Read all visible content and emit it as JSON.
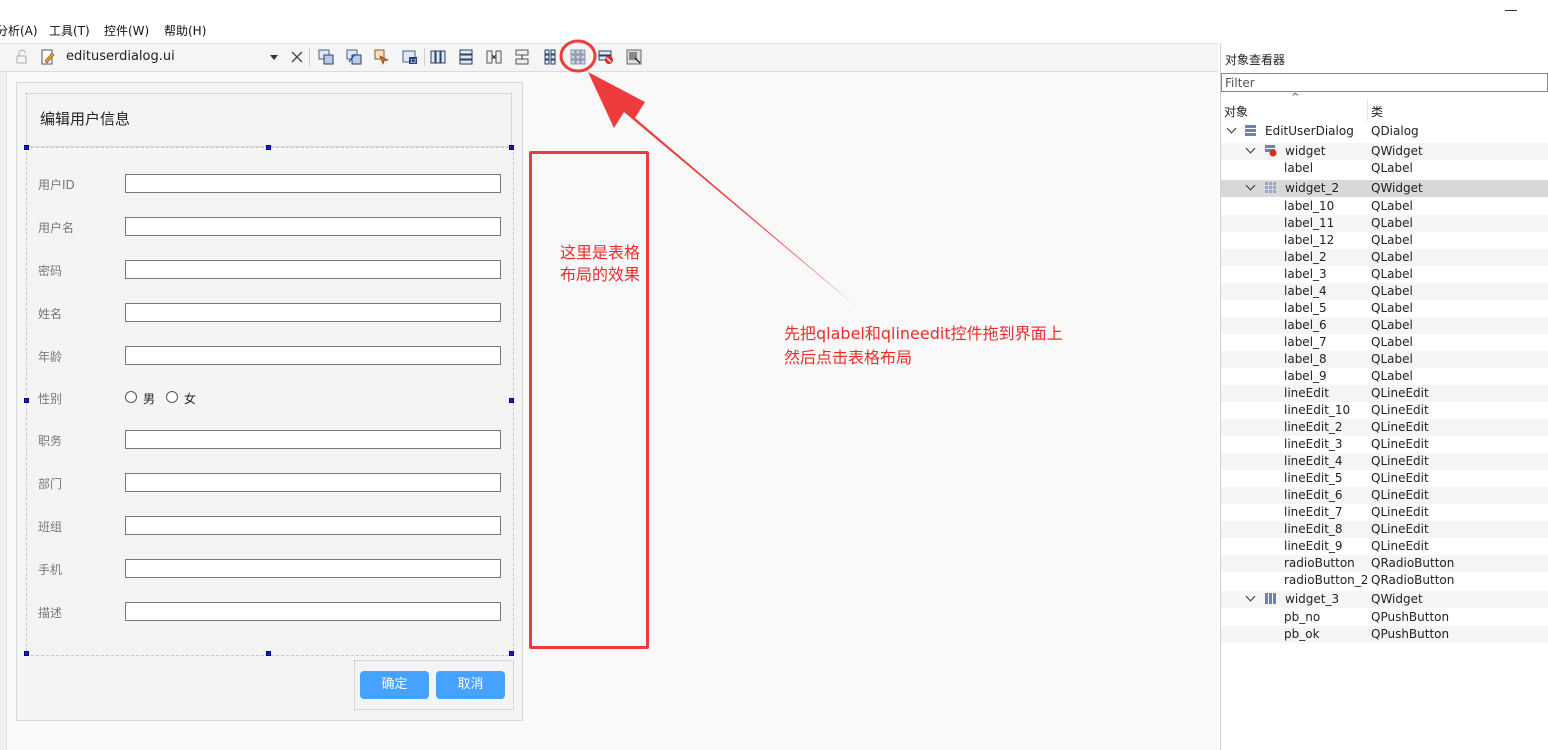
{
  "menubar": {
    "items": [
      {
        "label": "分析(A)"
      },
      {
        "label": "工具(T)"
      },
      {
        "label": "控件(W)"
      },
      {
        "label": "帮助(H)"
      }
    ]
  },
  "toolbar": {
    "file_name": "edituserdialog.ui",
    "icons": [
      "lock-icon",
      "edit-file-icon",
      "close-icon",
      "edit-widgets-icon",
      "edit-signals-slots-icon",
      "edit-buddies-icon",
      "edit-tab-order-icon",
      "layout-horizontal-icon",
      "layout-vertical-icon",
      "layout-horizontal-splitter-icon",
      "layout-vertical-splitter-icon",
      "layout-form-icon",
      "layout-grid-icon",
      "break-layout-icon",
      "adjust-size-icon"
    ]
  },
  "dialog": {
    "title": "编辑用户信息",
    "fields": [
      {
        "label": "用户ID"
      },
      {
        "label": "用户名"
      },
      {
        "label": "密码"
      },
      {
        "label": "姓名"
      },
      {
        "label": "年龄"
      },
      {
        "label": "性别"
      },
      {
        "label": "职务"
      },
      {
        "label": "部门"
      },
      {
        "label": "班组"
      },
      {
        "label": "手机"
      },
      {
        "label": "描述"
      }
    ],
    "radio_male": "男",
    "radio_female": "女",
    "ok_label": "确定",
    "cancel_label": "取消"
  },
  "annotations": {
    "layout_note": "这里是表格布局的效果",
    "instruction_line1": "先把qlabel和qlineedit控件拖到界面上",
    "instruction_line2": "然后点击表格布局"
  },
  "inspector": {
    "title": "对象查看器",
    "filter_placeholder": "Filter",
    "col_object": "对象",
    "col_class": "类",
    "rows": [
      {
        "name": "EditUserDialog",
        "cls": "QDialog"
      },
      {
        "name": "widget",
        "cls": "QWidget"
      },
      {
        "name": "label",
        "cls": "QLabel"
      },
      {
        "name": "widget_2",
        "cls": "QWidget"
      },
      {
        "name": "label_10",
        "cls": "QLabel"
      },
      {
        "name": "label_11",
        "cls": "QLabel"
      },
      {
        "name": "label_12",
        "cls": "QLabel"
      },
      {
        "name": "label_2",
        "cls": "QLabel"
      },
      {
        "name": "label_3",
        "cls": "QLabel"
      },
      {
        "name": "label_4",
        "cls": "QLabel"
      },
      {
        "name": "label_5",
        "cls": "QLabel"
      },
      {
        "name": "label_6",
        "cls": "QLabel"
      },
      {
        "name": "label_7",
        "cls": "QLabel"
      },
      {
        "name": "label_8",
        "cls": "QLabel"
      },
      {
        "name": "label_9",
        "cls": "QLabel"
      },
      {
        "name": "lineEdit",
        "cls": "QLineEdit"
      },
      {
        "name": "lineEdit_10",
        "cls": "QLineEdit"
      },
      {
        "name": "lineEdit_2",
        "cls": "QLineEdit"
      },
      {
        "name": "lineEdit_3",
        "cls": "QLineEdit"
      },
      {
        "name": "lineEdit_4",
        "cls": "QLineEdit"
      },
      {
        "name": "lineEdit_5",
        "cls": "QLineEdit"
      },
      {
        "name": "lineEdit_6",
        "cls": "QLineEdit"
      },
      {
        "name": "lineEdit_7",
        "cls": "QLineEdit"
      },
      {
        "name": "lineEdit_8",
        "cls": "QLineEdit"
      },
      {
        "name": "lineEdit_9",
        "cls": "QLineEdit"
      },
      {
        "name": "radioButton",
        "cls": "QRadioButton"
      },
      {
        "name": "radioButton_2",
        "cls": "QRadioButton"
      },
      {
        "name": "widget_3",
        "cls": "QWidget"
      },
      {
        "name": "pb_no",
        "cls": "QPushButton"
      },
      {
        "name": "pb_ok",
        "cls": "QPushButton"
      }
    ]
  },
  "colors": {
    "annotation_red": "#ee3b3b",
    "button_blue": "#46a2ff",
    "selection_gray": "#d8d8d8"
  }
}
